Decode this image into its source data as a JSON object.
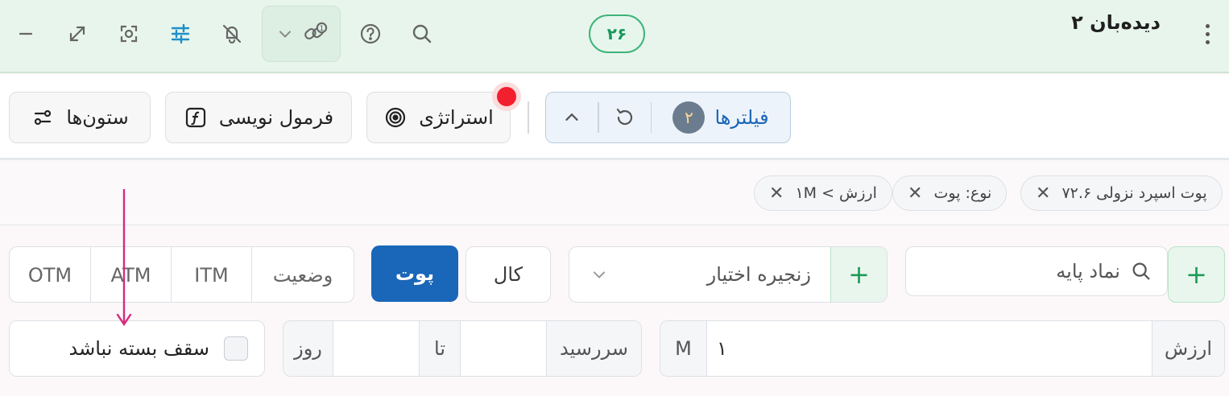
{
  "header": {
    "title": "دیده‌بان ۲",
    "count_badge": "۲۶",
    "icons": [
      "minimize-icon",
      "expand-icon",
      "focus-icon",
      "sliders-icon",
      "bell-off-icon",
      "chain-link-icon",
      "chevron-down-icon",
      "help-icon",
      "search-icon",
      "more-vert-icon"
    ]
  },
  "toolbar": {
    "columns_label": "ستون‌ها",
    "formula_label": "فرمول نویسی",
    "strategy_label": "استراتژی",
    "filters_label": "فیلترها",
    "filters_count": "۲"
  },
  "chips": [
    {
      "label": "پوت اسپرد نزولی ۷۲.۶"
    },
    {
      "label": "نوع: پوت"
    },
    {
      "label": "ارزش > ۱M"
    }
  ],
  "controls": {
    "underlying_placeholder": "نماد پایه",
    "chain_placeholder": "زنجیره اختیار",
    "call_label": "کال",
    "put_label": "پوت",
    "status_label": "وضعیت",
    "itm_label": "ITM",
    "atm_label": "ATM",
    "otm_label": "OTM",
    "value_label": "ارزش",
    "value_input": "۱",
    "value_unit": "M",
    "maturity_label": "سررسید",
    "to_label": "تا",
    "day_label": "روز",
    "no_cap_label": "سقف بسته نباشد"
  },
  "colors": {
    "header_bg": "#e8f5ec",
    "accent_green": "#17985a",
    "accent_blue": "#1a66b8",
    "alert_red": "#f21f2e",
    "annotation_arrow": "#d62a7f"
  }
}
